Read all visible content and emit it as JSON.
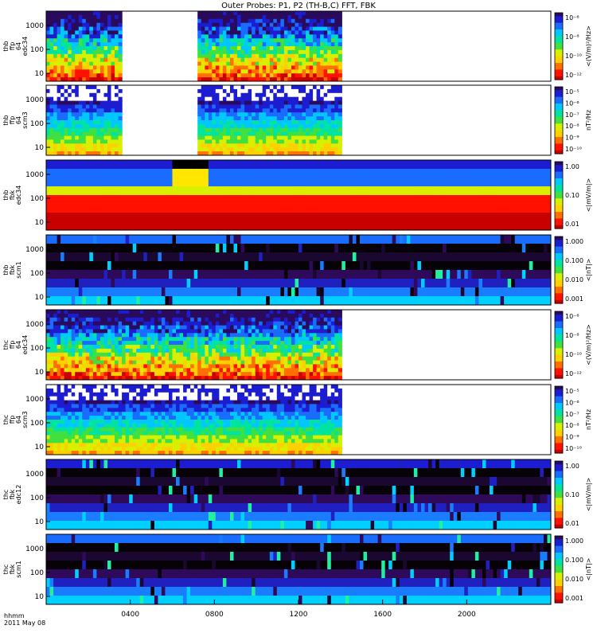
{
  "title": "Outer Probes: P1, P2 (TH-B,C) FFT, FBK",
  "time_axis": {
    "ticks": [
      "0400",
      "0800",
      "1200",
      "1600",
      "2000"
    ],
    "label_line1": "hhmm",
    "label_line2": "2011 May 08"
  },
  "colors": {
    "rainbow": [
      "#2a0a5c",
      "#1c1cd0",
      "#1a6cff",
      "#00c8ff",
      "#00e4a0",
      "#40e040",
      "#d8f000",
      "#ffd000",
      "#ff7000",
      "#ff1000",
      "#c80000"
    ],
    "dark": [
      "#060208",
      "#1a0830",
      "#300a5a",
      "#2020c0",
      "#1a7cff",
      "#00d0ff",
      "#20f0a0"
    ]
  },
  "panels": [
    {
      "ylabel": [
        "thb",
        "ffp",
        "64",
        "edc34"
      ],
      "unit": "<(V/m)²/Hz>",
      "yticks": [
        "1000",
        "100",
        "10"
      ],
      "cticks": [
        "10⁻⁶",
        "10⁻⁸",
        "10⁻¹⁰",
        "10⁻¹²"
      ],
      "kind": "fft_e"
    },
    {
      "ylabel": [
        "thb",
        "ffp",
        "64",
        "scm3"
      ],
      "unit": "nT²/Hz",
      "yticks": [
        "1000",
        "100",
        "10"
      ],
      "cticks": [
        "10⁻⁵",
        "10⁻⁶",
        "10⁻⁷",
        "10⁻⁸",
        "10⁻⁹",
        "10⁻¹⁰"
      ],
      "kind": "fft_b"
    },
    {
      "ylabel": [
        "thb",
        "fbk",
        "edc34"
      ],
      "unit": "<|mV/m|>",
      "yticks": [
        "1000",
        "100",
        "10"
      ],
      "cticks": [
        "1.00",
        "0.10",
        "0.01"
      ],
      "kind": "fbk_e"
    },
    {
      "ylabel": [
        "thb",
        "fbk",
        "scm1"
      ],
      "unit": "<|nT|>",
      "yticks": [
        "1000",
        "100",
        "10"
      ],
      "cticks": [
        "1.000",
        "0.100",
        "0.010",
        "0.001"
      ],
      "kind": "fbk_b"
    },
    {
      "ylabel": [
        "thc",
        "ffp",
        "64",
        "edc34"
      ],
      "unit": "<(V/m)²/Hz>",
      "yticks": [
        "1000",
        "100",
        "10"
      ],
      "cticks": [
        "10⁻⁶",
        "10⁻⁸",
        "10⁻¹⁰",
        "10⁻¹²"
      ],
      "kind": "fft_e2"
    },
    {
      "ylabel": [
        "thc",
        "ffp",
        "64",
        "scm3"
      ],
      "unit": "nT²/Hz",
      "yticks": [
        "1000",
        "100",
        "10"
      ],
      "cticks": [
        "10⁻⁵",
        "10⁻⁶",
        "10⁻⁷",
        "10⁻⁸",
        "10⁻⁹",
        "10⁻¹⁰"
      ],
      "kind": "fft_b"
    },
    {
      "ylabel": [
        "thc",
        "fbk",
        "edc12"
      ],
      "unit": "<|mV/m|>",
      "yticks": [
        "1000",
        "100",
        "10"
      ],
      "cticks": [
        "1.00",
        "0.10",
        "0.01"
      ],
      "kind": "fbk_e2"
    },
    {
      "ylabel": [
        "thc",
        "fbk",
        "scm1"
      ],
      "unit": "<|nT|>",
      "yticks": [
        "1000",
        "100",
        "10"
      ],
      "cticks": [
        "1.000",
        "0.100",
        "0.010",
        "0.001"
      ],
      "kind": "fbk_b"
    }
  ],
  "chart_data": {
    "type": "heatmap",
    "title": "Outer Probes: P1, P2 (TH-B,C) FFT, FBK",
    "xlabel": "hhmm",
    "x_ticks": [
      "0400",
      "0800",
      "1200",
      "1600",
      "2000"
    ],
    "x_range_hours": [
      0,
      24
    ],
    "date": "2011 May 08",
    "y_scale": "log",
    "data_coverage_hours": {
      "thb_ffp_edc34": [
        [
          0.0,
          1.9
        ],
        [
          1.9,
          3.6
        ],
        [
          7.2,
          8.1
        ],
        [
          8.1,
          10.2
        ],
        [
          10.2,
          11.4
        ],
        [
          11.4,
          12.6
        ],
        [
          12.6,
          14.1
        ]
      ],
      "thb_ffp_scm3": [
        [
          0.0,
          3.6
        ],
        [
          7.2,
          14.1
        ]
      ],
      "thb_fbk_edc34": [
        [
          0.0,
          24.0
        ]
      ],
      "thb_fbk_scm1": [
        [
          0.0,
          24.0
        ]
      ],
      "thc_ffp_edc34": [
        [
          0.0,
          14.1
        ]
      ],
      "thc_ffp_scm3": [
        [
          0.0,
          14.1
        ]
      ],
      "thc_fbk_edc12": [
        [
          0.0,
          24.0
        ]
      ],
      "thc_fbk_scm1": [
        [
          0.0,
          24.0
        ]
      ]
    }
  }
}
